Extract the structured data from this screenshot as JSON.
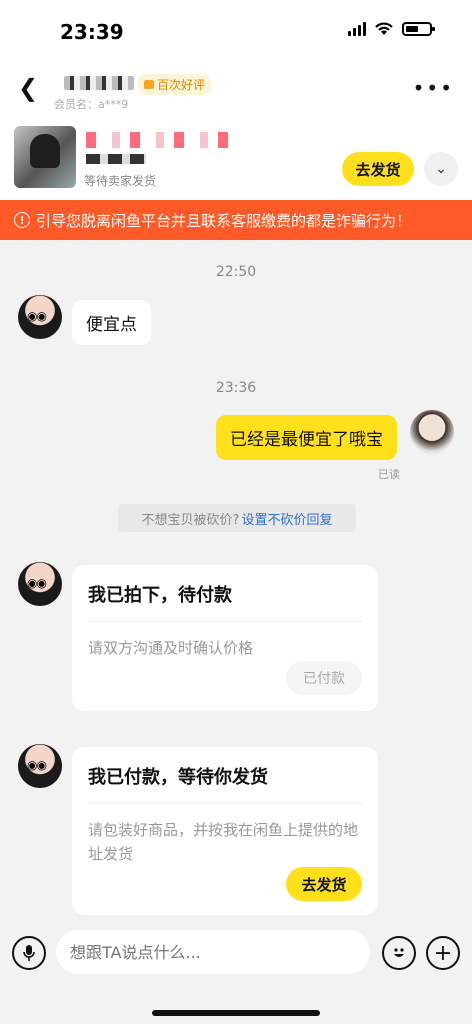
{
  "status": {
    "time": "23:39"
  },
  "header": {
    "badge": "百次好评",
    "member_id": "会员名：a***9",
    "back_icon": "back-arrow-icon",
    "more_icon": "more-dots-icon"
  },
  "product": {
    "status_text": "等待卖家发货",
    "ship_button": "去发货",
    "expand_icon": "chevron-down-icon"
  },
  "warning": {
    "icon": "!",
    "text": "引导您脱离闲鱼平台并且联系客服缴费的都是诈骗行为！"
  },
  "messages": {
    "time1": "22:50",
    "buyer_msg1": "便宜点",
    "time2": "23:36",
    "seller_msg1": "已经是最便宜了哦宝",
    "read_status": "已读"
  },
  "notice": {
    "text": "不想宝贝被砍价?",
    "link": "设置不砍价回复"
  },
  "card1": {
    "title": "我已拍下，待付款",
    "body": "请双方沟通及时确认价格",
    "button": "已付款"
  },
  "card2": {
    "title": "我已付款，等待你发货",
    "body": "请包装好商品，并按我在闲鱼上提供的地址发货",
    "button": "去发货"
  },
  "input_bar": {
    "placeholder": "想跟TA说点什么..."
  }
}
